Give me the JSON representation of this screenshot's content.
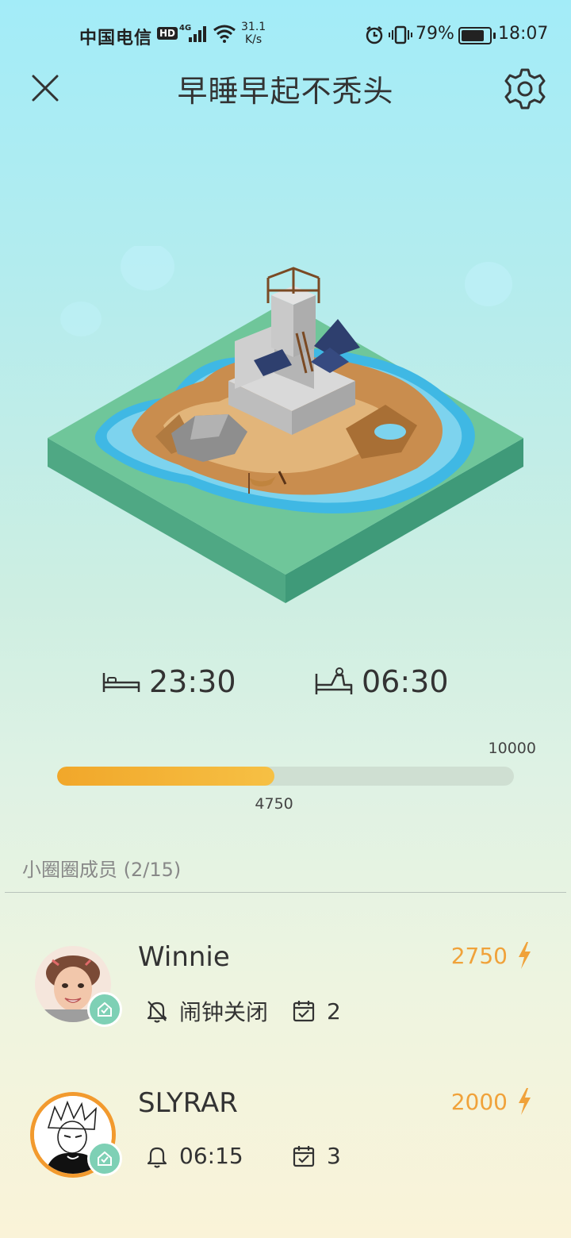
{
  "status_bar": {
    "carrier": "中国电信",
    "hd": "HD",
    "network": "4G",
    "speed_value": "31.1",
    "speed_unit": "K/s",
    "battery": "79%",
    "time": "18:07"
  },
  "header": {
    "title": "早睡早起不秃头"
  },
  "schedule": {
    "sleep_time": "23:30",
    "wake_time": "06:30"
  },
  "progress": {
    "goal": "10000",
    "current": "4750",
    "fraction": 0.475
  },
  "members": {
    "title": "小圈圈成员 (2/15)",
    "list": [
      {
        "name": "Winnie",
        "score": "2750",
        "alarm_text": "闹钟关闭",
        "alarm_on": false,
        "checkins": "2"
      },
      {
        "name": "SLYRAR",
        "score": "2000",
        "alarm_text": "06:15",
        "alarm_on": true,
        "checkins": "3"
      }
    ]
  },
  "colors": {
    "accent_orange": "#f0a23a",
    "progress_fill": "#f1a72a",
    "verify_green": "#7ed0b5",
    "grass": "#6fc69a",
    "water": "#3fb8e4"
  },
  "icons": [
    "close-icon",
    "gear-icon",
    "bed-icon",
    "wake-up-icon",
    "bolt-icon",
    "bell-off-icon",
    "bell-icon",
    "calendar-check-icon",
    "verified-icon"
  ]
}
